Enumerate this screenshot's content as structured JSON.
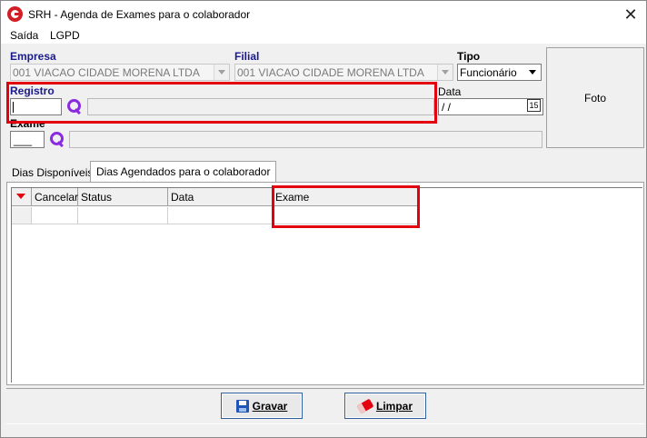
{
  "window": {
    "title": "SRH - Agenda de Exames para o colaborador",
    "close_symbol": "✕"
  },
  "menu": {
    "items": [
      "Saída",
      "LGPD"
    ]
  },
  "form": {
    "empresa": {
      "label": "Empresa",
      "value": "001 VIACAO CIDADE MORENA LTDA"
    },
    "filial": {
      "label": "Filial",
      "value": "001 VIACAO CIDADE MORENA LTDA"
    },
    "tipo": {
      "label": "Tipo",
      "value": "Funcionário"
    },
    "registro": {
      "label": "Registro",
      "value": "",
      "name": ""
    },
    "data": {
      "label": "Data",
      "value": " /  /",
      "calendar_text": "15"
    },
    "exame": {
      "label": "Exame",
      "value": "___",
      "name": ""
    },
    "foto": {
      "label": "Foto"
    }
  },
  "tabs": [
    {
      "label": "Dias Disponíveis",
      "active": false
    },
    {
      "label": "Dias Agendados para o colaborador",
      "active": true
    }
  ],
  "grid": {
    "columns": [
      "Cancelar",
      "Status",
      "Data",
      "Exame"
    ],
    "rows": [
      [
        "",
        "",
        "",
        ""
      ]
    ]
  },
  "buttons": {
    "save": "Gravar",
    "clear": "Limpar"
  },
  "icons": {
    "app": "app-logo-icon",
    "search": "search-icon",
    "calendar": "calendar-icon",
    "save": "floppy-disk-icon",
    "clear": "eraser-icon"
  },
  "colors": {
    "highlight": "#e3000f",
    "accent": "#8a2be2",
    "label_blue": "#1a1a8c"
  }
}
